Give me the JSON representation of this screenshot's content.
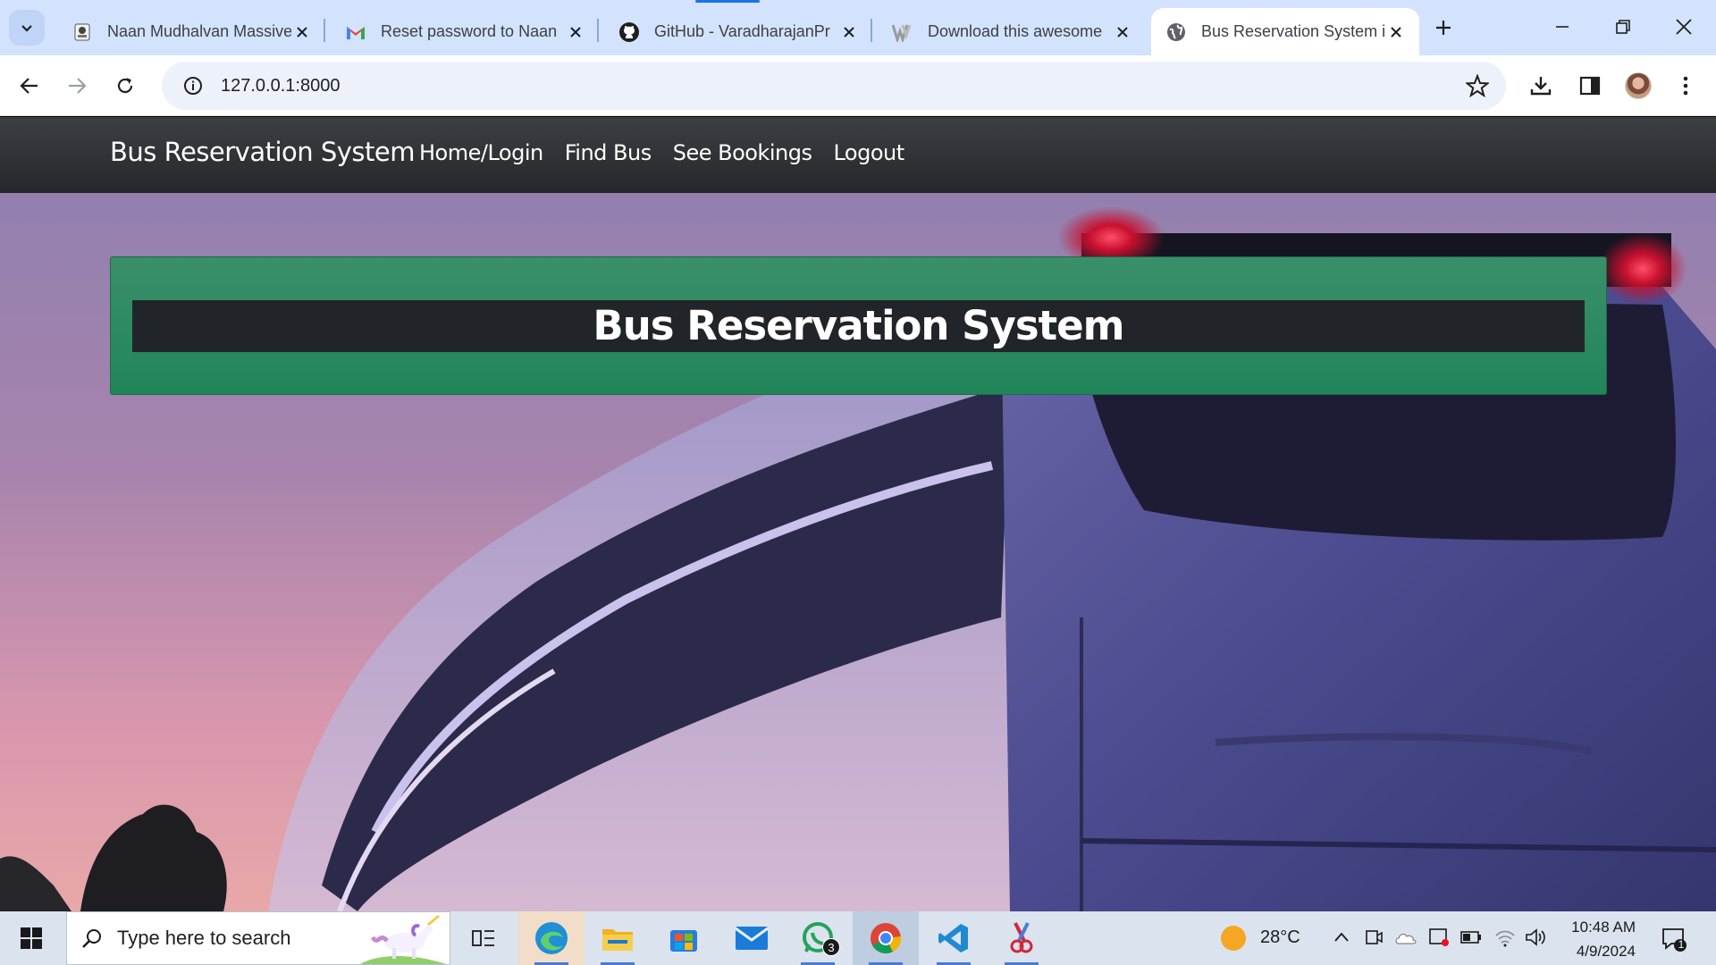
{
  "browser": {
    "tabs": [
      {
        "title": "Naan Mudhalvan Massive",
        "favicon": "graduation-icon"
      },
      {
        "title": "Reset password to Naan",
        "favicon": "gmail-icon"
      },
      {
        "title": "GitHub - VaradharajanPr",
        "favicon": "github-icon"
      },
      {
        "title": "Download this awesome",
        "favicon": "w-icon"
      },
      {
        "title": "Bus Reservation System i",
        "favicon": "globe-icon",
        "active": true
      }
    ],
    "url": "127.0.0.1:8000"
  },
  "site": {
    "brand": "Bus Reservation System",
    "nav": [
      "Home/Login",
      "Find Bus",
      "See Bookings",
      "Logout"
    ],
    "hero_title": "Bus Reservation System"
  },
  "taskbar": {
    "search_placeholder": "Type here to search",
    "whatsapp_badge": "3",
    "weather": "28°C",
    "time": "10:48 AM",
    "date": "4/9/2024",
    "notifications": "1"
  },
  "colors": {
    "tabstrip": "#d3e3fd",
    "navbar": "#2b2e31",
    "hero_green": "#21855a",
    "hero_title_bg": "#212529"
  }
}
